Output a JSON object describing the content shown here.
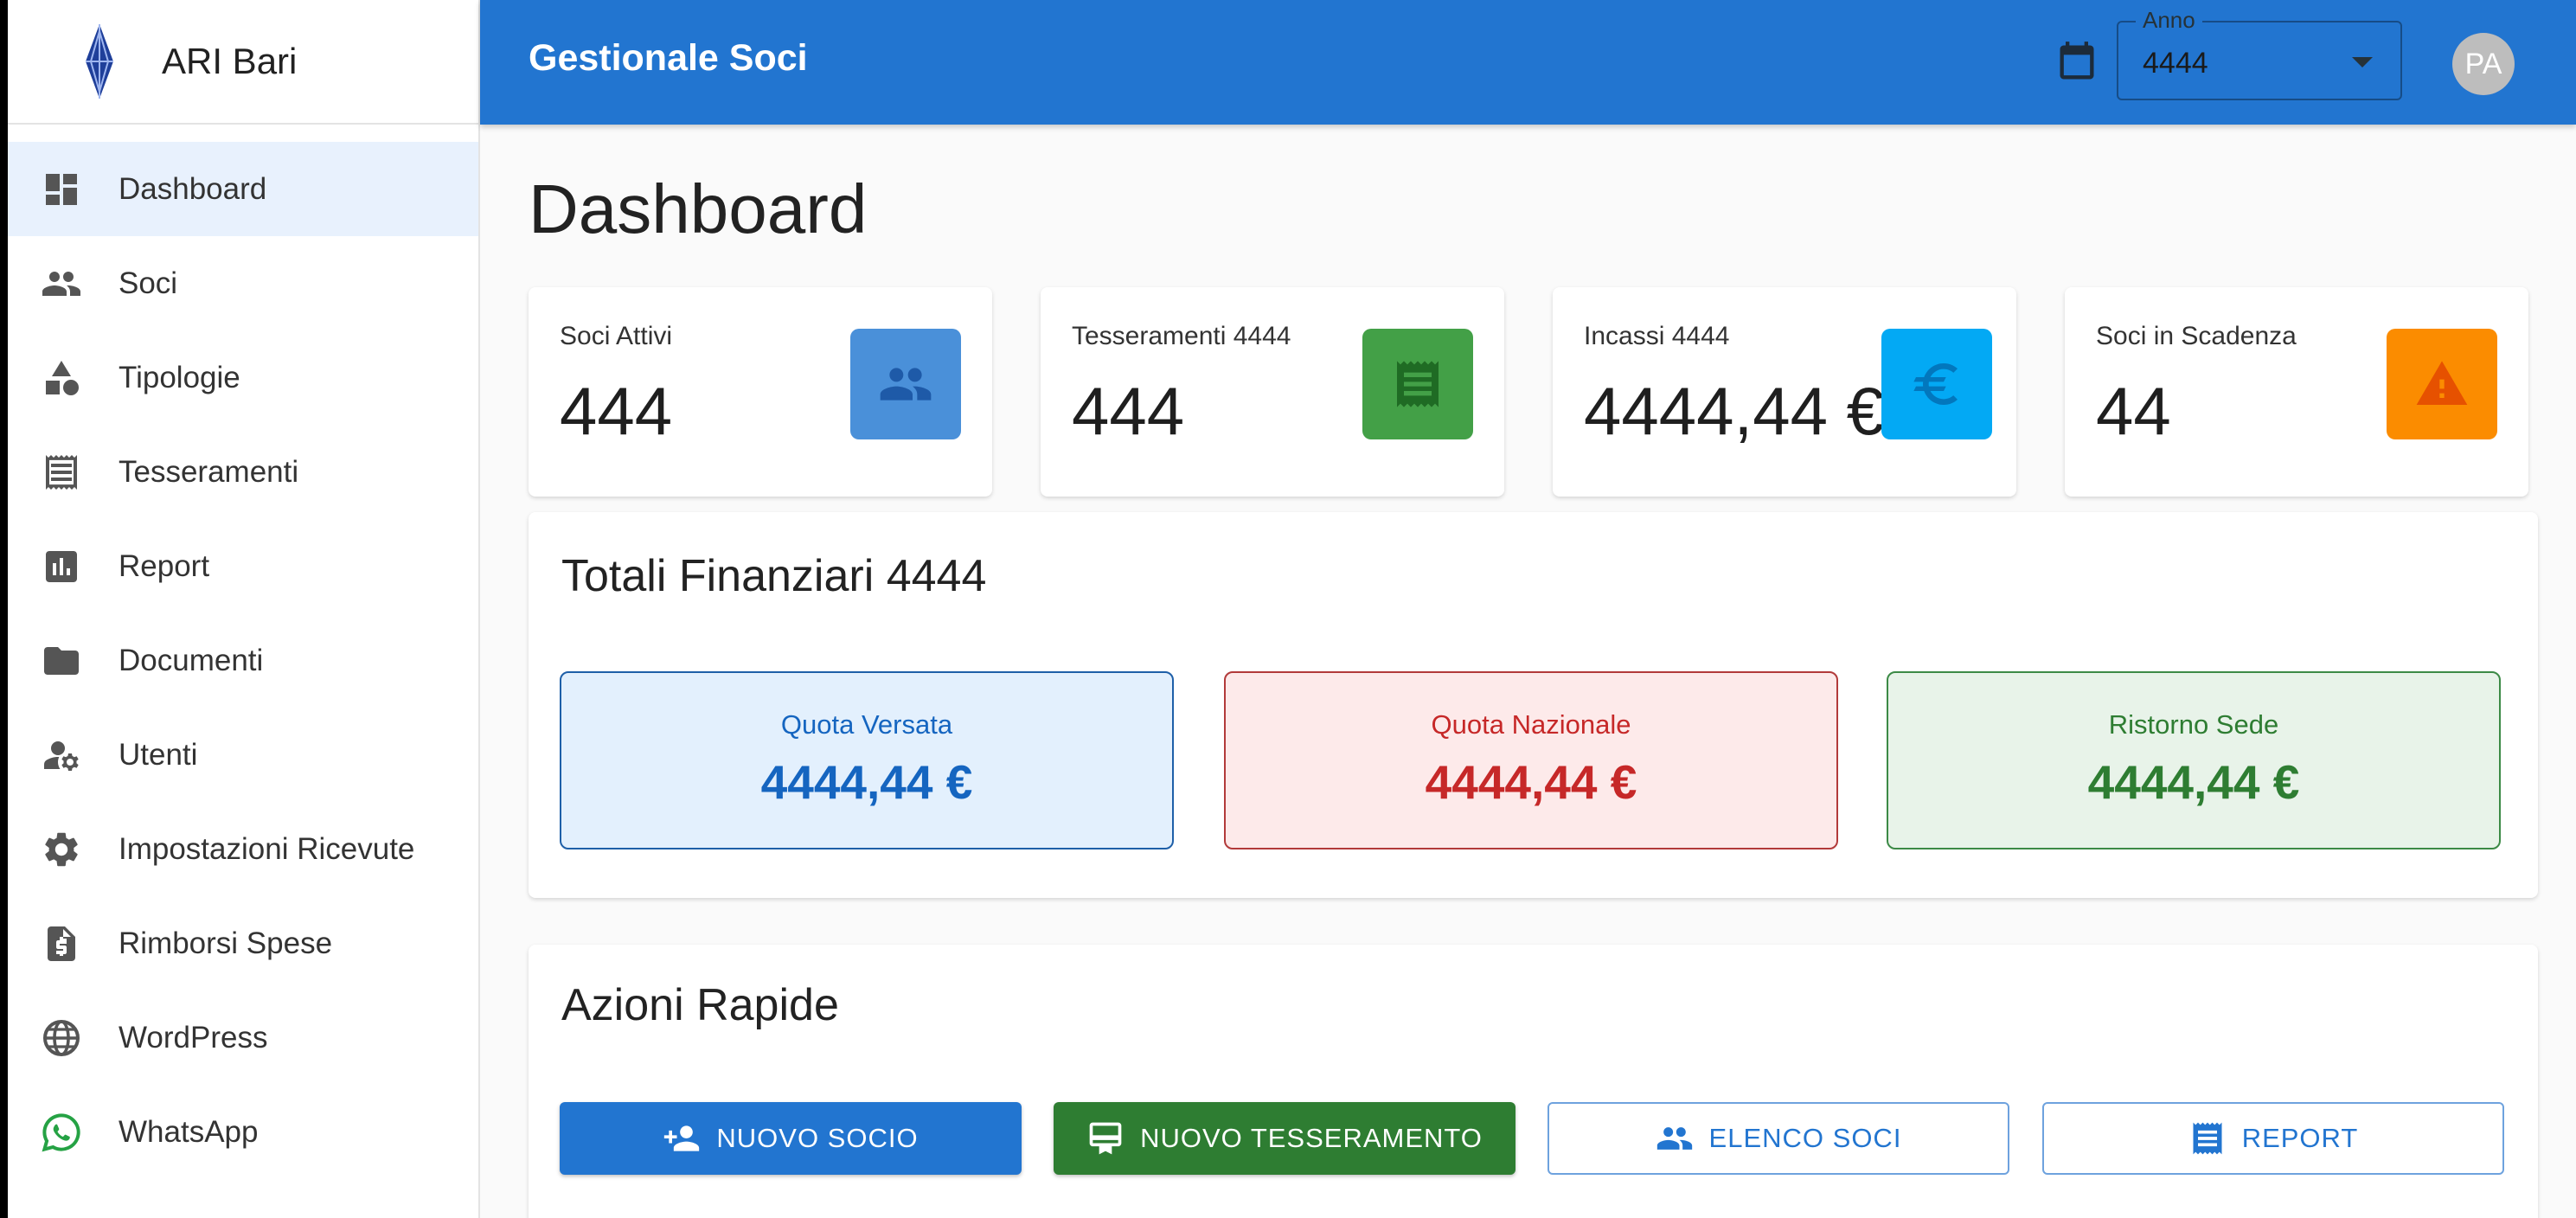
{
  "sidebar": {
    "brand": "ARI Bari",
    "items": [
      {
        "label": "Dashboard",
        "icon": "dashboard-icon"
      },
      {
        "label": "Soci",
        "icon": "people-icon"
      },
      {
        "label": "Tipologie",
        "icon": "category-icon"
      },
      {
        "label": "Tesseramenti",
        "icon": "receipt-icon"
      },
      {
        "label": "Report",
        "icon": "bar-chart-icon"
      },
      {
        "label": "Documenti",
        "icon": "folder-icon"
      },
      {
        "label": "Utenti",
        "icon": "manage-accounts-icon"
      },
      {
        "label": "Impostazioni Ricevute",
        "icon": "gear-icon"
      },
      {
        "label": "Rimborsi Spese",
        "icon": "request-quote-icon"
      },
      {
        "label": "WordPress",
        "icon": "globe-icon"
      },
      {
        "label": "WhatsApp",
        "icon": "whatsapp-icon"
      }
    ]
  },
  "topbar": {
    "title": "Gestionale Soci",
    "year_label": "Anno",
    "year_value": "4444",
    "avatar_initials": "PA"
  },
  "main": {
    "title": "Dashboard",
    "stats": [
      {
        "label": "Soci Attivi",
        "value": "444",
        "color": "#4a90d9",
        "icon": "people-icon"
      },
      {
        "label": "Tesseramenti 4444",
        "value": "444",
        "color": "#43a047",
        "icon": "receipt-icon"
      },
      {
        "label": "Incassi 4444",
        "value": "4444,44 €",
        "color": "#03a9f4",
        "icon": "euro-icon"
      },
      {
        "label": "Soci in Scadenza",
        "value": "44",
        "color": "#fb8c00",
        "icon": "warning-icon"
      }
    ],
    "financial": {
      "title": "Totali Finanziari 4444",
      "boxes": [
        {
          "label": "Quota Versata",
          "value": "4444,44 €",
          "text_color": "#1565c0",
          "bg": "#e3f0fd",
          "border": "#1e5fa8"
        },
        {
          "label": "Quota Nazionale",
          "value": "4444,44 €",
          "text_color": "#c62828",
          "bg": "#fdeaea",
          "border": "#b23a3a"
        },
        {
          "label": "Ristorno Sede",
          "value": "4444,44 €",
          "text_color": "#2e7d32",
          "bg": "#e8f3e9",
          "border": "#3c8a46"
        }
      ]
    },
    "quick_actions": {
      "title": "Azioni Rapide",
      "buttons": [
        {
          "label": "NUOVO SOCIO",
          "icon": "person-add-icon",
          "style": "filled",
          "color": "#2275d0"
        },
        {
          "label": "NUOVO TESSERAMENTO",
          "icon": "card-membership-icon",
          "style": "filled",
          "color": "#2e7d32"
        },
        {
          "label": "ELENCO SOCI",
          "icon": "people-icon",
          "style": "outline",
          "color": "#2275d0"
        },
        {
          "label": "REPORT",
          "icon": "receipt-icon",
          "style": "outline",
          "color": "#2275d0"
        }
      ]
    }
  }
}
